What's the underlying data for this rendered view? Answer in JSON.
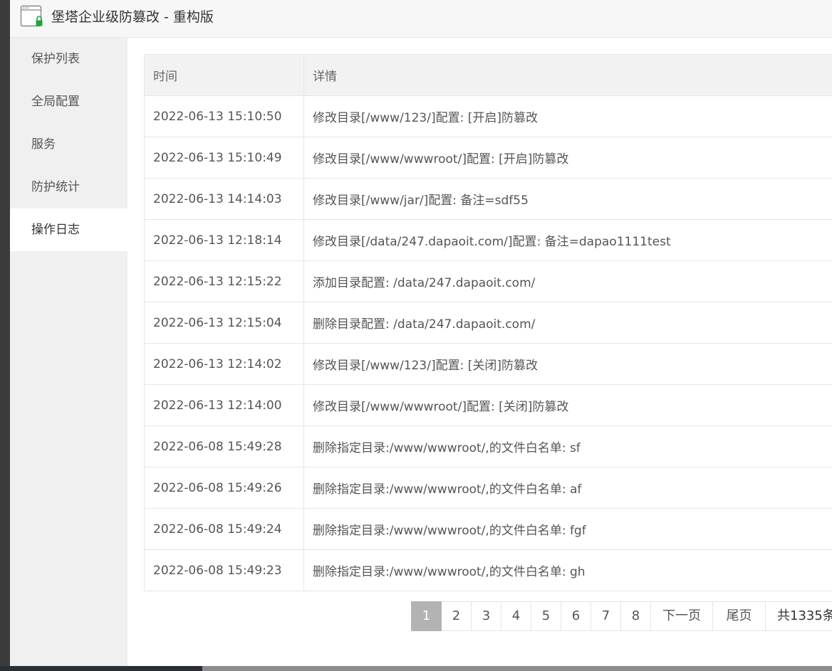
{
  "window": {
    "title": "堡塔企业级防篡改 - 重构版"
  },
  "sidebar": {
    "items": [
      {
        "label": "保护列表"
      },
      {
        "label": "全局配置"
      },
      {
        "label": "服务"
      },
      {
        "label": "防护统计"
      },
      {
        "label": "操作日志",
        "active": true
      }
    ]
  },
  "table": {
    "headers": {
      "time": "时间",
      "detail": "详情"
    },
    "rows": [
      {
        "time": "2022-06-13 15:10:50",
        "detail": "修改目录[/www/123/]配置: [开启]防篡改"
      },
      {
        "time": "2022-06-13 15:10:49",
        "detail": "修改目录[/www/wwwroot/]配置: [开启]防篡改"
      },
      {
        "time": "2022-06-13 14:14:03",
        "detail": "修改目录[/www/jar/]配置: 备注=sdf55"
      },
      {
        "time": "2022-06-13 12:18:14",
        "detail": "修改目录[/data/247.dapaoit.com/]配置: 备注=dapao1111test"
      },
      {
        "time": "2022-06-13 12:15:22",
        "detail": "添加目录配置: /data/247.dapaoit.com/"
      },
      {
        "time": "2022-06-13 12:15:04",
        "detail": "删除目录配置: /data/247.dapaoit.com/"
      },
      {
        "time": "2022-06-13 12:14:02",
        "detail": "修改目录[/www/123/]配置: [关闭]防篡改"
      },
      {
        "time": "2022-06-13 12:14:00",
        "detail": "修改目录[/www/wwwroot/]配置: [关闭]防篡改"
      },
      {
        "time": "2022-06-08 15:49:28",
        "detail": "删除指定目录:/www/wwwroot/,的文件白名单: sf"
      },
      {
        "time": "2022-06-08 15:49:26",
        "detail": "删除指定目录:/www/wwwroot/,的文件白名单: af"
      },
      {
        "time": "2022-06-08 15:49:24",
        "detail": "删除指定目录:/www/wwwroot/,的文件白名单: fgf"
      },
      {
        "time": "2022-06-08 15:49:23",
        "detail": "删除指定目录:/www/wwwroot/,的文件白名单: gh"
      }
    ]
  },
  "pagination": {
    "pages": [
      "1",
      "2",
      "3",
      "4",
      "5",
      "6",
      "7",
      "8"
    ],
    "current": "1",
    "next_label": "下一页",
    "last_label": "尾页",
    "total_label": "共1335条"
  },
  "colors": {
    "sidebar_bg": "#f0f0f0",
    "active_page_bg": "#b3b3b3",
    "lock_green": "#22a33a"
  }
}
